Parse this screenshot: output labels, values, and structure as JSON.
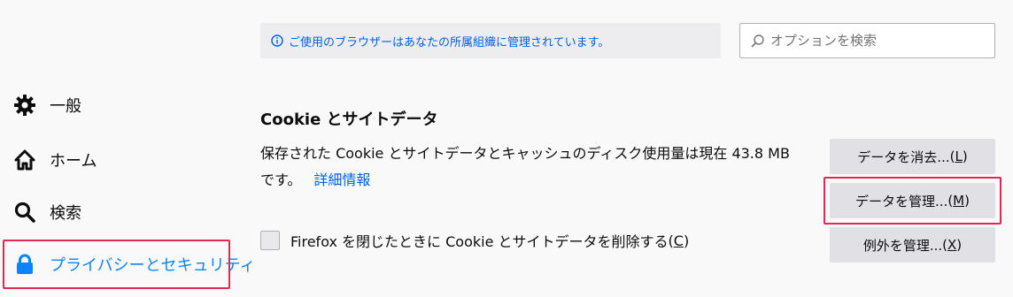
{
  "policy_notice": {
    "text": "ご使用のブラウザーはあなたの所属組織に管理されています。"
  },
  "search": {
    "placeholder": "オプションを検索"
  },
  "sidebar": {
    "items": [
      {
        "label": "一般",
        "icon": "gear-icon"
      },
      {
        "label": "ホーム",
        "icon": "home-icon"
      },
      {
        "label": "検索",
        "icon": "search-icon"
      },
      {
        "label": "プライバシーとセキュリティ",
        "icon": "lock-icon",
        "selected": true
      }
    ]
  },
  "cookies": {
    "title": "Cookie とサイトデータ",
    "description": "保存された Cookie とサイトデータとキャッシュのディスク使用量は現在 43.8 MB です。",
    "learn_more": "詳細情報",
    "checkbox_label": "Firefox を閉じたときに Cookie とサイトデータを削除する",
    "checkbox_accesskey": "C",
    "checkbox_checked": false,
    "buttons": {
      "clear": {
        "label": "データを消去...",
        "accesskey": "L"
      },
      "manage": {
        "label": "データを管理...",
        "accesskey": "M"
      },
      "exceptions": {
        "label": "例外を管理...",
        "accesskey": "X"
      }
    }
  },
  "colors": {
    "accent": "#0a84ff",
    "link": "#0060df",
    "highlight": "#e22850",
    "background": "#f9f9fa"
  }
}
